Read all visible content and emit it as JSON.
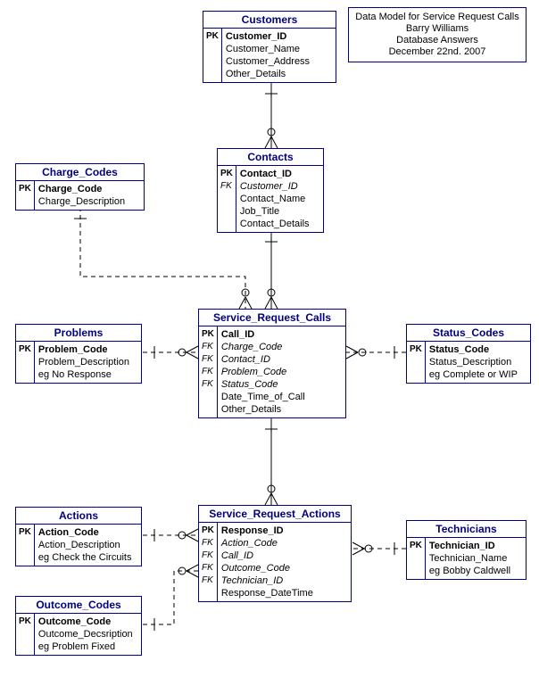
{
  "note": {
    "line1": "Data Model for Service Request Calls",
    "line2": "Barry Williams",
    "line3": "Database Answers",
    "line4": "December 22nd. 2007"
  },
  "entities": {
    "customers": {
      "title": "Customers",
      "rows": [
        {
          "key": "PK",
          "keyClass": "pk",
          "field": "Customer_ID",
          "fieldClass": "pk"
        },
        {
          "key": "",
          "field": "Customer_Name"
        },
        {
          "key": "",
          "field": "Customer_Address"
        },
        {
          "key": "",
          "field": "Other_Details"
        }
      ]
    },
    "contacts": {
      "title": "Contacts",
      "rows": [
        {
          "key": "PK",
          "keyClass": "pk",
          "field": "Contact_ID",
          "fieldClass": "pk"
        },
        {
          "key": "FK",
          "keyClass": "fk",
          "field": "Customer_ID",
          "fieldClass": "fk"
        },
        {
          "key": "",
          "field": "Contact_Name"
        },
        {
          "key": "",
          "field": "Job_Title"
        },
        {
          "key": "",
          "field": "Contact_Details"
        }
      ]
    },
    "charge_codes": {
      "title": "Charge_Codes",
      "rows": [
        {
          "key": "PK",
          "keyClass": "pk",
          "field": "Charge_Code",
          "fieldClass": "pk"
        },
        {
          "key": "",
          "field": "Charge_Description"
        }
      ]
    },
    "problems": {
      "title": "Problems",
      "rows": [
        {
          "key": "PK",
          "keyClass": "pk",
          "field": "Problem_Code",
          "fieldClass": "pk"
        },
        {
          "key": "",
          "field": "Problem_Description"
        },
        {
          "key": "",
          "field": "eg No Response"
        }
      ]
    },
    "status_codes": {
      "title": "Status_Codes",
      "rows": [
        {
          "key": "PK",
          "keyClass": "pk",
          "field": "Status_Code",
          "fieldClass": "pk"
        },
        {
          "key": "",
          "field": "Status_Description"
        },
        {
          "key": "",
          "field": "eg Complete or WIP"
        }
      ]
    },
    "service_request_calls": {
      "title": "Service_Request_Calls",
      "rows": [
        {
          "key": "PK",
          "keyClass": "pk",
          "field": "Call_ID",
          "fieldClass": "pk"
        },
        {
          "key": "FK",
          "keyClass": "fk",
          "field": "Charge_Code",
          "fieldClass": "fk"
        },
        {
          "key": "FK",
          "keyClass": "fk",
          "field": "Contact_ID",
          "fieldClass": "fk"
        },
        {
          "key": "FK",
          "keyClass": "fk",
          "field": "Problem_Code",
          "fieldClass": "fk"
        },
        {
          "key": "FK",
          "keyClass": "fk",
          "field": "Status_Code",
          "fieldClass": "fk"
        },
        {
          "key": "",
          "field": "Date_Time_of_Call"
        },
        {
          "key": "",
          "field": "Other_Details"
        }
      ]
    },
    "actions": {
      "title": "Actions",
      "rows": [
        {
          "key": "PK",
          "keyClass": "pk",
          "field": "Action_Code",
          "fieldClass": "pk"
        },
        {
          "key": "",
          "field": "Action_Description"
        },
        {
          "key": "",
          "field": "eg Check the Circuits"
        }
      ]
    },
    "outcome_codes": {
      "title": "Outcome_Codes",
      "rows": [
        {
          "key": "PK",
          "keyClass": "pk",
          "field": "Outcome_Code",
          "fieldClass": "pk"
        },
        {
          "key": "",
          "field": "Outcome_Decsription"
        },
        {
          "key": "",
          "field": "eg Problem Fixed"
        }
      ]
    },
    "technicians": {
      "title": "Technicians",
      "rows": [
        {
          "key": "PK",
          "keyClass": "pk",
          "field": "Technician_ID",
          "fieldClass": "pk"
        },
        {
          "key": "",
          "field": "Technician_Name"
        },
        {
          "key": "",
          "field": "eg Bobby Caldwell"
        }
      ]
    },
    "service_request_actions": {
      "title": "Service_Request_Actions",
      "rows": [
        {
          "key": "PK",
          "keyClass": "pk",
          "field": "Response_ID",
          "fieldClass": "pk"
        },
        {
          "key": "FK",
          "keyClass": "fk",
          "field": "Action_Code",
          "fieldClass": "fk"
        },
        {
          "key": "FK",
          "keyClass": "fk",
          "field": "Call_ID",
          "fieldClass": "fk"
        },
        {
          "key": "FK",
          "keyClass": "fk",
          "field": "Outcome_Code",
          "fieldClass": "fk"
        },
        {
          "key": "FK",
          "keyClass": "fk",
          "field": "Technician_ID",
          "fieldClass": "fk"
        },
        {
          "key": "",
          "field": "Response_DateTime"
        }
      ]
    }
  }
}
